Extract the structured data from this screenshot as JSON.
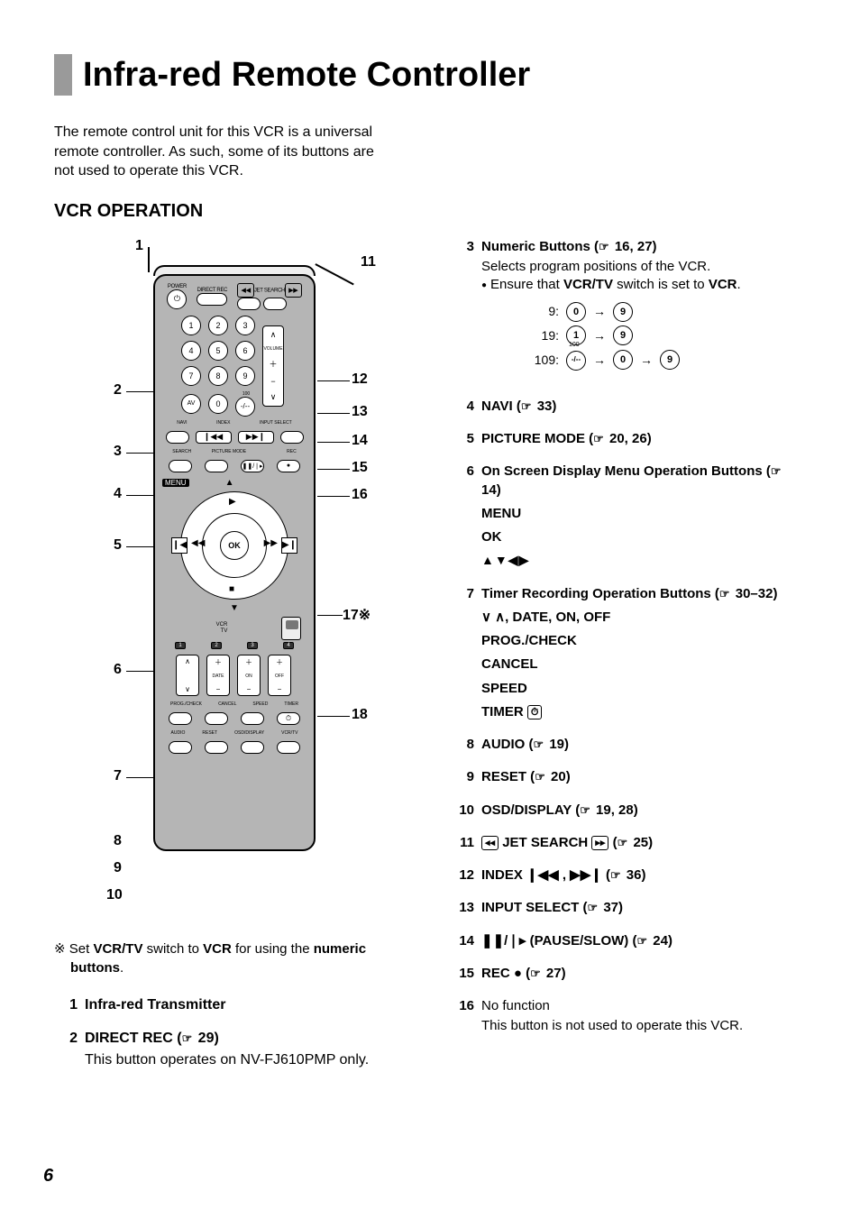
{
  "page_number": "6",
  "title": "Infra-red Remote Controller",
  "intro": "The remote control unit for this VCR is a universal remote controller. As such, some of its buttons are not used to operate this VCR.",
  "section_heading": "VCR OPERATION",
  "diagram": {
    "callouts_left": [
      "1",
      "2",
      "3",
      "4",
      "5",
      "6",
      "7",
      "8",
      "9",
      "10"
    ],
    "callouts_right": [
      "11",
      "12",
      "13",
      "14",
      "15",
      "16",
      "17※",
      "18"
    ],
    "top_labels": {
      "power": "POWER",
      "direct_rec": "DIRECT REC",
      "jet_search_l": "◂◂",
      "jet_search": "JET SEARCH",
      "jet_search_r": "▸▸"
    },
    "numeric": {
      "av": "AV",
      "hundred": "-/--",
      "hundred_sup": "100",
      "volume": "VOLUME"
    },
    "mid_labels": {
      "navi": "NAVI",
      "index": "INDEX",
      "input_select": "INPUT SELECT",
      "search": "SEARCH",
      "picture_mode": "PICTURE MODE",
      "pause_slow": "❚❚/❘▸",
      "rec": "REC"
    },
    "menu": "MENU",
    "ok": "OK",
    "vcr": "VCR",
    "tv": "TV",
    "timer_cols": {
      "date": "DATE",
      "on": "ON",
      "off": "OFF"
    },
    "bottom_labels": {
      "prog_check": "PROG./CHECK",
      "cancel": "CANCEL",
      "speed": "SPEED",
      "timer": "TIMER",
      "audio": "AUDIO",
      "reset": "RESET",
      "osd": "OSD/DISPLAY",
      "vcrtv": "VCR/TV"
    }
  },
  "diagram_footnote": {
    "marker": "※",
    "pre": "Set ",
    "b1": "VCR/TV",
    "mid": " switch to ",
    "b2": "VCR",
    "post1": " for using the ",
    "b3": "numeric buttons",
    "post2": "."
  },
  "left_items": [
    {
      "n": "1",
      "title": "Infra-red Transmitter"
    },
    {
      "n": "2",
      "title": "DIRECT REC (",
      "ref": "29",
      "title_end": ")",
      "note": "This button operates on NV-FJ610PMP only."
    }
  ],
  "right_items": [
    {
      "n": "3",
      "title": "Numeric Buttons (",
      "ref": "16, 27",
      "title_end": ")",
      "note_plain": "Selects program positions of the VCR.",
      "bullet_pre": "Ensure that ",
      "bullet_b1": "VCR/TV",
      "bullet_mid": " switch is set to ",
      "bullet_b2": "VCR",
      "bullet_post": ".",
      "keyseq": [
        {
          "label": "9:",
          "keys": [
            "0",
            "9"
          ]
        },
        {
          "label": "19:",
          "keys": [
            "1",
            "9"
          ]
        },
        {
          "label": "109:",
          "keys": [
            "-/--",
            "0",
            "9"
          ],
          "sup": "100"
        }
      ]
    },
    {
      "n": "4",
      "title": "NAVI (",
      "ref": "33",
      "title_end": ")"
    },
    {
      "n": "5",
      "title": "PICTURE MODE (",
      "ref": "20, 26",
      "title_end": ")"
    },
    {
      "n": "6",
      "title": "On Screen Display Menu Operation Buttons (",
      "ref": "14",
      "title_end": ")",
      "subs": [
        "MENU",
        "OK",
        "▲▼◀▶"
      ]
    },
    {
      "n": "7",
      "title": "Timer Recording Operation Buttons (",
      "ref": "30–32",
      "title_end": ")",
      "subs": [
        "∨ ∧, DATE, ON, OFF",
        "PROG./CHECK",
        "CANCEL",
        "SPEED",
        "TIMER ⏱"
      ]
    },
    {
      "n": "8",
      "title": "AUDIO (",
      "ref": "19",
      "title_end": ")"
    },
    {
      "n": "9",
      "title": "RESET (",
      "ref": "20",
      "title_end": ")"
    },
    {
      "n": "10",
      "title": "OSD/DISPLAY (",
      "ref": "19, 28",
      "title_end": ")"
    },
    {
      "n": "11",
      "title_pre": "",
      "icon_l": "◂◂",
      "title_mid": " JET SEARCH ",
      "icon_r": "▸▸",
      "title": " (",
      "ref": "25",
      "title_end": ")"
    },
    {
      "n": "12",
      "title": "INDEX ❙◀◀ , ▶▶❙  (",
      "ref": "36",
      "title_end": ")"
    },
    {
      "n": "13",
      "title": "INPUT SELECT (",
      "ref": "37",
      "title_end": ")"
    },
    {
      "n": "14",
      "title": "❚❚/❘▸ (PAUSE/SLOW) (",
      "ref": "24",
      "title_end": ")"
    },
    {
      "n": "15",
      "title": "REC ● (",
      "ref": "27",
      "title_end": ")"
    },
    {
      "n": "16",
      "title_plain": "No function",
      "note": "This button is not used to operate this VCR."
    }
  ]
}
